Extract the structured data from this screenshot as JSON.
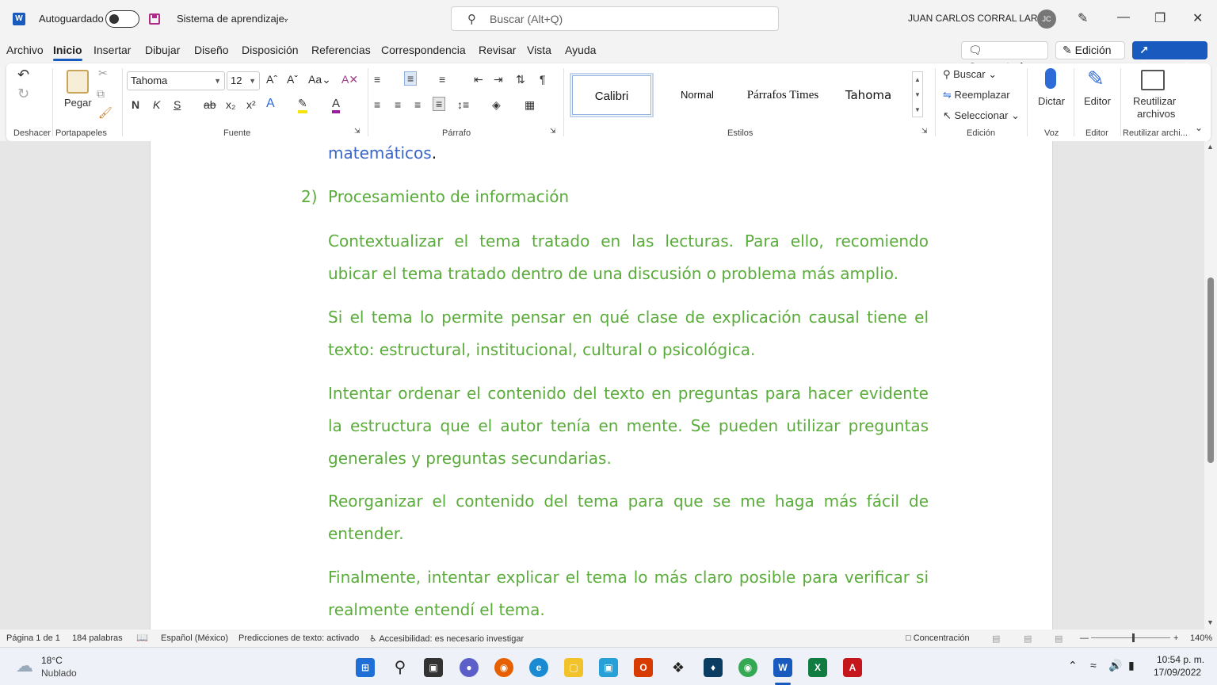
{
  "titlebar": {
    "app_logo": "W",
    "autosave_label": "Autoguardado",
    "doc_title": "Sistema de aprendizaje.",
    "search_placeholder": "Buscar (Alt+Q)",
    "user_name": "JUAN CARLOS CORRAL LARA",
    "user_initials": "JC"
  },
  "menu": {
    "tabs": [
      "Archivo",
      "Inicio",
      "Insertar",
      "Dibujar",
      "Diseño",
      "Disposición",
      "Referencias",
      "Correspondencia",
      "Revisar",
      "Vista",
      "Ayuda"
    ],
    "active_tab": "Inicio",
    "comments_label": "Comentarios",
    "edit_mode_label": "Edición",
    "share_label": "Compartir"
  },
  "ribbon": {
    "undo_group": "Deshacer",
    "clipboard_group": "Portapapeles",
    "paste_label": "Pegar",
    "font_group": "Fuente",
    "font_name": "Tahoma",
    "font_size": "12",
    "paragraph_group": "Párrafo",
    "styles_group": "Estilos",
    "styles": [
      "Calibri",
      "Normal",
      "Párrafos Times",
      "Tahoma"
    ],
    "editing_group": "Edición",
    "find_label": "Buscar",
    "replace_label": "Reemplazar",
    "select_label": "Seleccionar",
    "voice_group": "Voz",
    "dictate_label": "Dictar",
    "editor_group": "Editor",
    "editor_label": "Editor",
    "reuse_group": "Reutilizar archi...",
    "reuse_label_1": "Reutilizar",
    "reuse_label_2": "archivos",
    "bold": "N",
    "italic": "K",
    "underline": "S"
  },
  "document": {
    "top_fragment": "matemáticos",
    "top_fragment_end": ".",
    "list_number": "2)",
    "heading": "Procesamiento de información",
    "paragraphs": [
      "Contextualizar el tema tratado en las lecturas. Para ello, recomiendo ubicar el tema tratado dentro de una discusión o problema más amplio.",
      "Si el tema lo permite pensar en qué clase de explicación causal tiene el texto: estructural, institucional, cultural o psicológica.",
      "Intentar ordenar el contenido del texto en preguntas para hacer evidente la estructura que el autor tenía en mente. Se pueden utilizar preguntas generales y preguntas secundarias.",
      "Reorganizar el contenido del tema para que se me haga más fácil de entender.",
      "Finalmente, intentar explicar el tema lo más claro posible para verificar si realmente entendí el tema."
    ]
  },
  "statusbar": {
    "page": "Página 1 de 1",
    "words": "184 palabras",
    "language": "Español (México)",
    "predictions": "Predicciones de texto: activado",
    "accessibility": "Accesibilidad: es necesario investigar",
    "focus": "Concentración",
    "zoom": "140%"
  },
  "taskbar": {
    "temperature": "18°C",
    "weather": "Nublado",
    "time": "10:54 p. m.",
    "date": "17/09/2022"
  },
  "colors": {
    "accent": "#185abd",
    "doc_green": "#5aac3b",
    "doc_blue": "#3a66c6"
  }
}
